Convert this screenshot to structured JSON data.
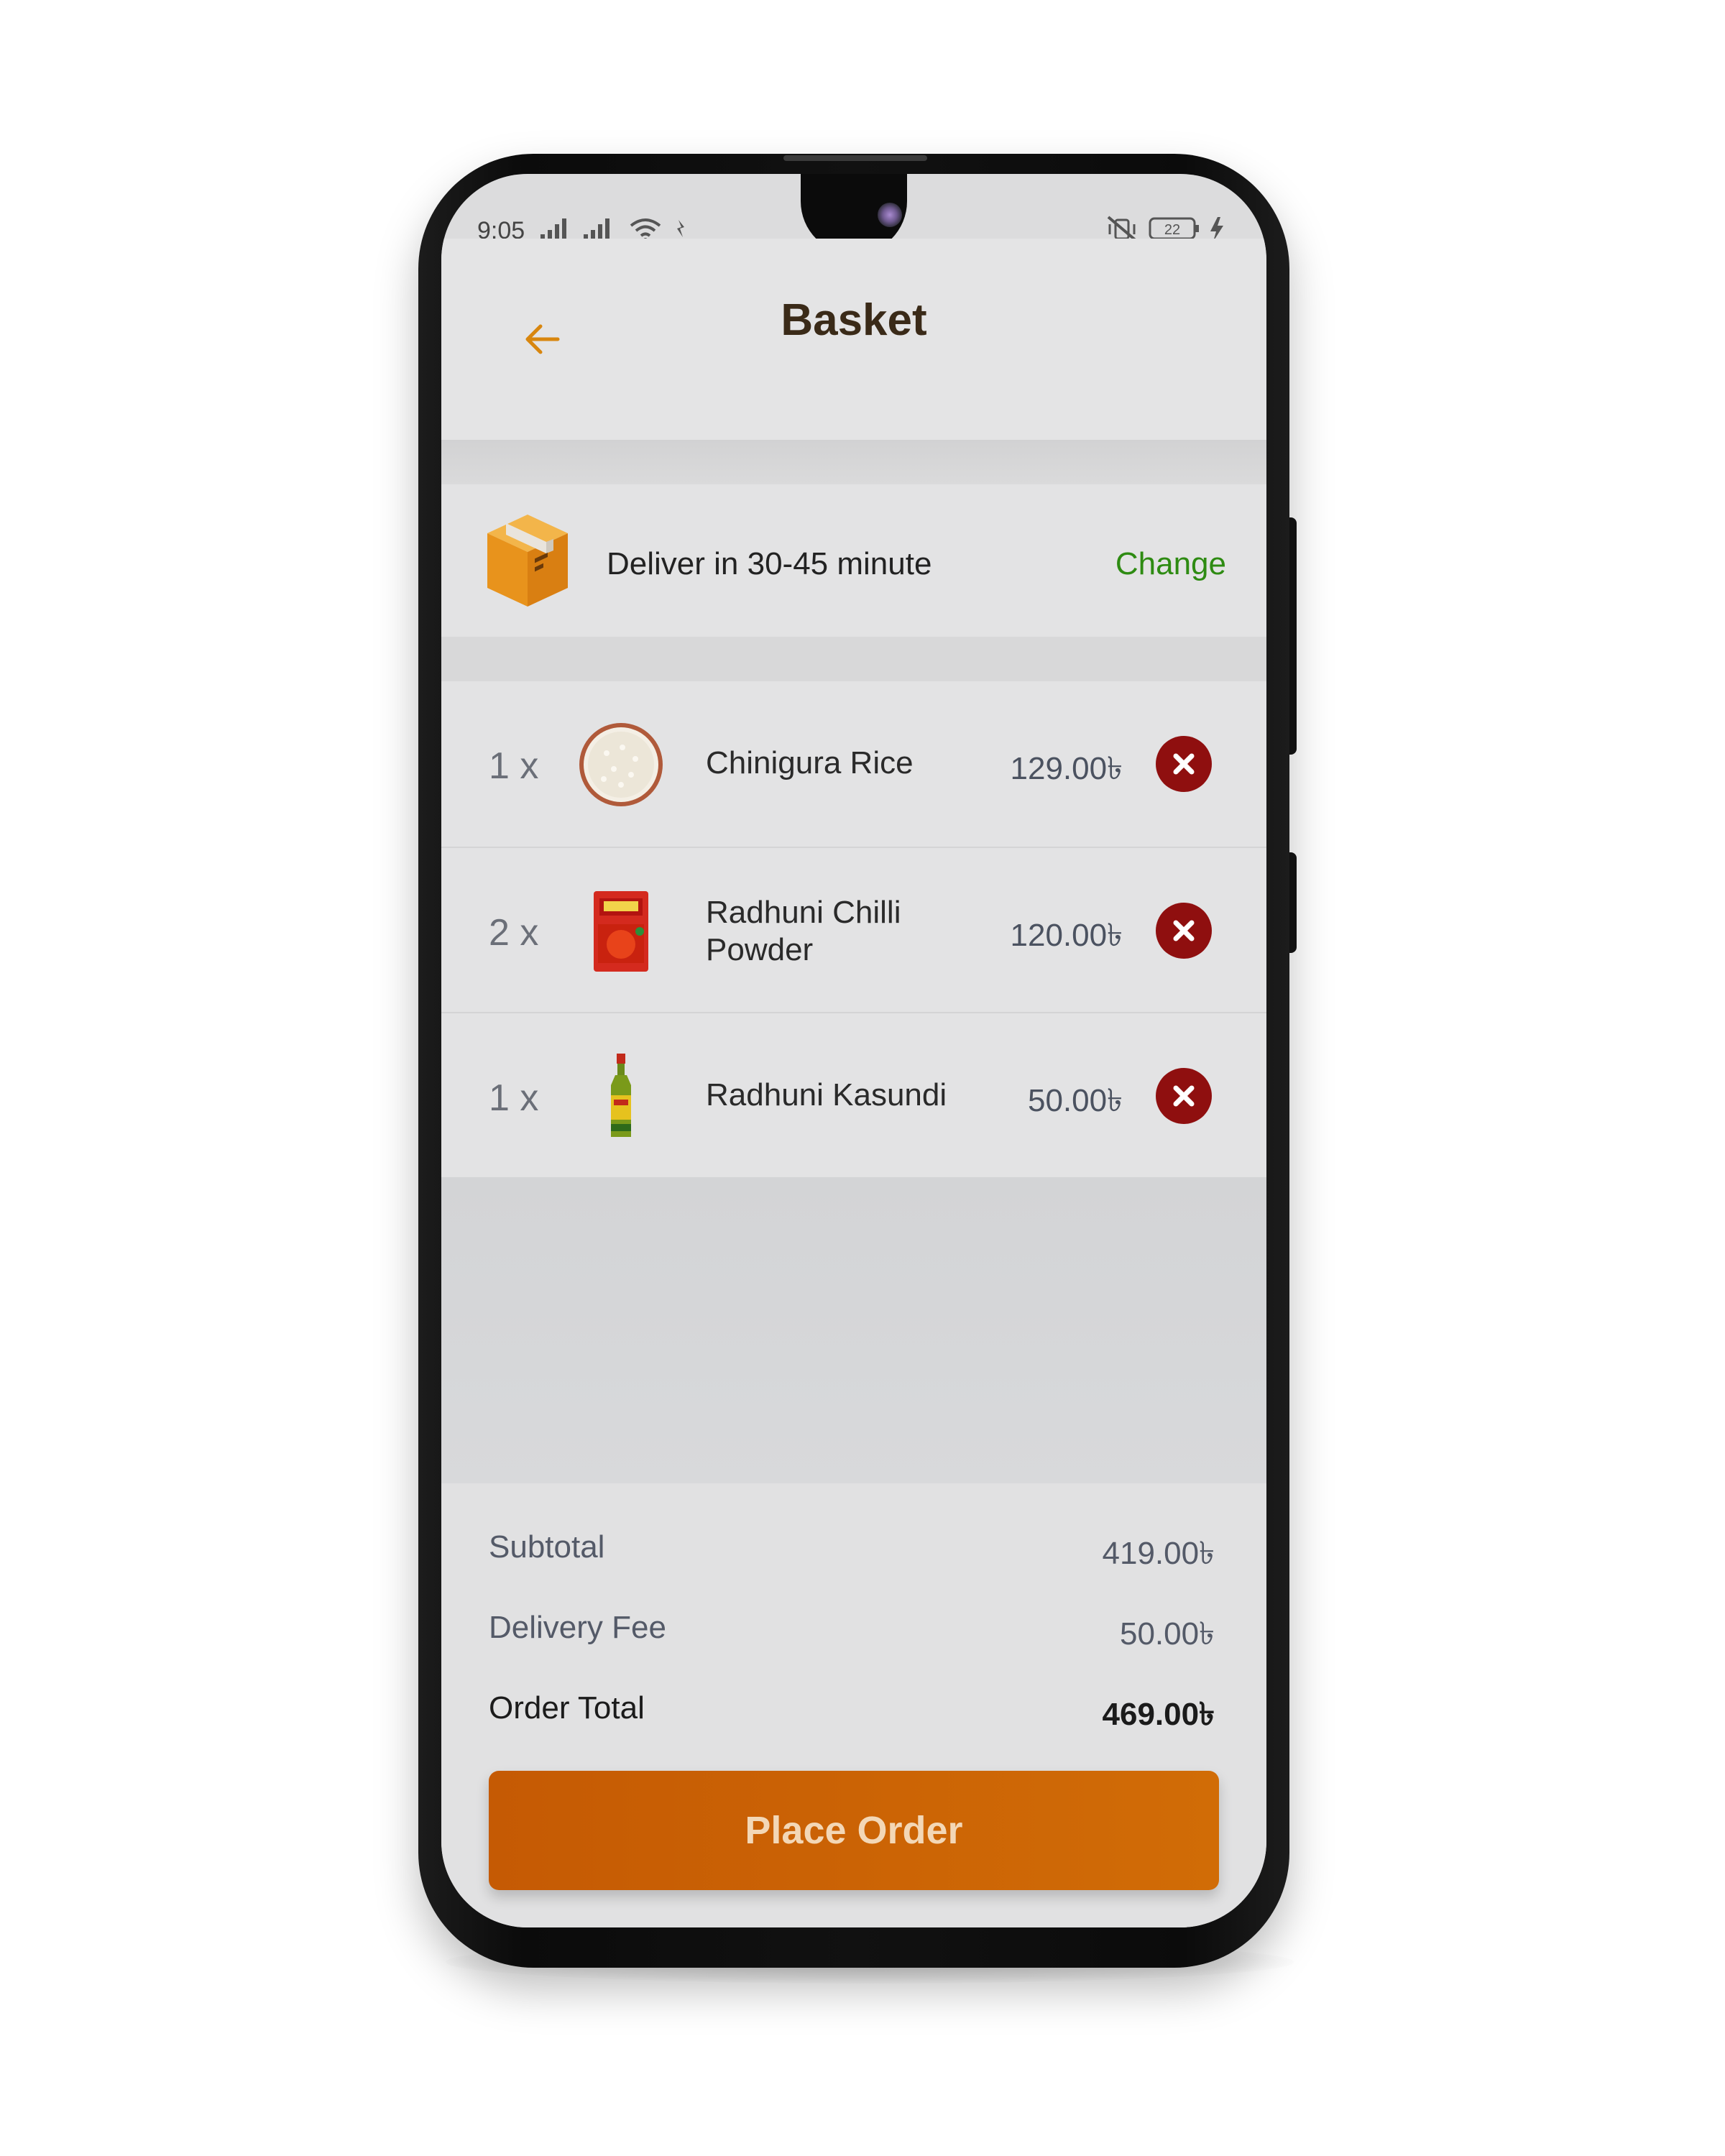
{
  "status_bar": {
    "time": "9:05",
    "battery": "22"
  },
  "header": {
    "title": "Basket"
  },
  "delivery": {
    "text": "Deliver in 30-45 minute",
    "change_label": "Change"
  },
  "items": [
    {
      "qty": "1 x",
      "name": "Chinigura Rice",
      "price": "129.00৳"
    },
    {
      "qty": "2 x",
      "name": "Radhuni Chilli Powder",
      "price": "120.00৳"
    },
    {
      "qty": "1 x",
      "name": "Radhuni Kasundi",
      "price": "50.00৳"
    }
  ],
  "summary": {
    "subtotal_label": "Subtotal",
    "subtotal_value": "419.00৳",
    "delivery_fee_label": "Delivery Fee",
    "delivery_fee_value": "50.00৳",
    "order_total_label": "Order Total",
    "order_total_value": "469.00৳"
  },
  "place_order_label": "Place Order",
  "colors": {
    "accent": "#c95f05",
    "change_link": "#2e8b12",
    "remove_button": "#8f0f0f",
    "title": "#3a2a18"
  },
  "icons": {
    "back": "back-arrow-icon",
    "delivery": "package-box-icon",
    "remove": "remove-x-icon"
  }
}
